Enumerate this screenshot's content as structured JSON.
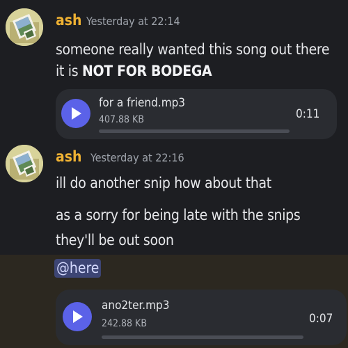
{
  "messages": [
    {
      "author": "ash",
      "timestamp": "Yesterday at 22:14",
      "lines": [
        "someone really wanted this song out there",
        "it is "
      ],
      "bold": "NOT FOR BODEGA",
      "attachment": {
        "filename": "for a friend.mp3",
        "size": "407.88 KB",
        "duration": "0:11",
        "progress": 0
      }
    },
    {
      "author": "ash",
      "timestamp": "Yesterday at 22:16",
      "lines": [
        "ill do another snip how about that",
        "as a sorry for being late with the snips",
        "they'll be out soon"
      ],
      "mention": "@here",
      "attachment": {
        "filename": "ano2ter.mp3",
        "size": "242.88 KB",
        "duration": "0:07",
        "progress": 0
      }
    }
  ],
  "colors": {
    "username": "#f0b233",
    "accent": "#5b62e8",
    "mention_bg": "#3d4574",
    "highlight_bg": "#2c2820"
  }
}
